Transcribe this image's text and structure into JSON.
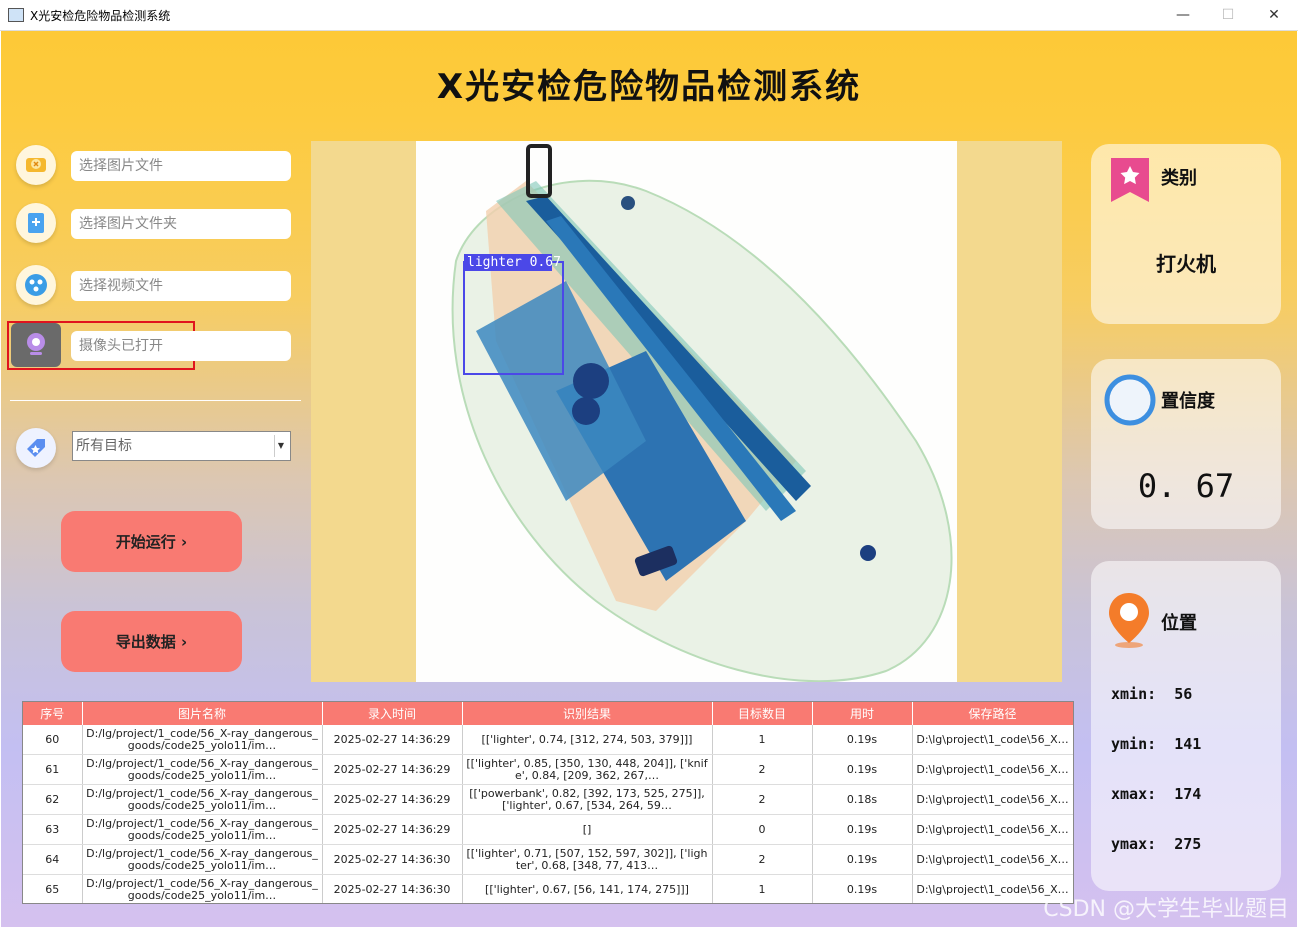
{
  "window": {
    "title": "X光安检危险物品检测系统",
    "minimize": "—",
    "maximize": "☐",
    "close": "✕"
  },
  "header": {
    "title": "X光安检危险物品检测系统"
  },
  "sidebar": {
    "select_image": "选择图片文件",
    "select_folder": "选择图片文件夹",
    "select_video": "选择视频文件",
    "camera": "摄像头已打开",
    "target_select": "所有目标",
    "run_button": "开始运行 ›",
    "export_button": "导出数据 ›"
  },
  "detection": {
    "label": "lighter  0.67"
  },
  "cards": {
    "class": {
      "label": "类别",
      "value": "打火机"
    },
    "confidence": {
      "label": "置信度",
      "value": "0. 67"
    },
    "position": {
      "label": "位置",
      "xmin_label": "xmin:",
      "xmin": "56",
      "ymin_label": "ymin:",
      "ymin": "141",
      "xmax_label": "xmax:",
      "xmax": "174",
      "ymax_label": "ymax:",
      "ymax": "275"
    }
  },
  "table": {
    "headers": [
      "序号",
      "图片名称",
      "录入时间",
      "识别结果",
      "目标数目",
      "用时",
      "保存路径"
    ],
    "rows": [
      [
        "60",
        "D:/lg/project/1_code/56_X-ray_dangerous_goods/code25_yolo11/im…",
        "2025-02-27 14:36:29",
        "[['lighter', 0.74, [312, 274, 503, 379]]]",
        "1",
        "0.19s",
        "D:\\lg\\project\\1_code\\56_X…"
      ],
      [
        "61",
        "D:/lg/project/1_code/56_X-ray_dangerous_goods/code25_yolo11/im…",
        "2025-02-27 14:36:29",
        "[['lighter', 0.85, [350, 130, 448, 204]], ['knife', 0.84, [209, 362, 267,…",
        "2",
        "0.19s",
        "D:\\lg\\project\\1_code\\56_X…"
      ],
      [
        "62",
        "D:/lg/project/1_code/56_X-ray_dangerous_goods/code25_yolo11/im…",
        "2025-02-27 14:36:29",
        "[['powerbank', 0.82, [392, 173, 525, 275]], ['lighter', 0.67, [534, 264, 59…",
        "2",
        "0.18s",
        "D:\\lg\\project\\1_code\\56_X…"
      ],
      [
        "63",
        "D:/lg/project/1_code/56_X-ray_dangerous_goods/code25_yolo11/im…",
        "2025-02-27 14:36:29",
        "[]",
        "0",
        "0.19s",
        "D:\\lg\\project\\1_code\\56_X…"
      ],
      [
        "64",
        "D:/lg/project/1_code/56_X-ray_dangerous_goods/code25_yolo11/im…",
        "2025-02-27 14:36:30",
        "[['lighter', 0.71, [507, 152, 597, 302]], ['lighter', 0.68, [348, 77, 413…",
        "2",
        "0.19s",
        "D:\\lg\\project\\1_code\\56_X…"
      ],
      [
        "65",
        "D:/lg/project/1_code/56_X-ray_dangerous_goods/code25_yolo11/im…",
        "2025-02-27 14:36:30",
        "[['lighter', 0.67, [56, 141, 174, 275]]]",
        "1",
        "0.19s",
        "D:\\lg\\project\\1_code\\56_X…"
      ]
    ]
  },
  "watermark": "CSDN @大学生毕业题目",
  "colors": {
    "accent": "#f97a72",
    "header_bg": "#fdc937",
    "highlight_box": "#e0141e",
    "detect_box": "#4b48e8"
  }
}
